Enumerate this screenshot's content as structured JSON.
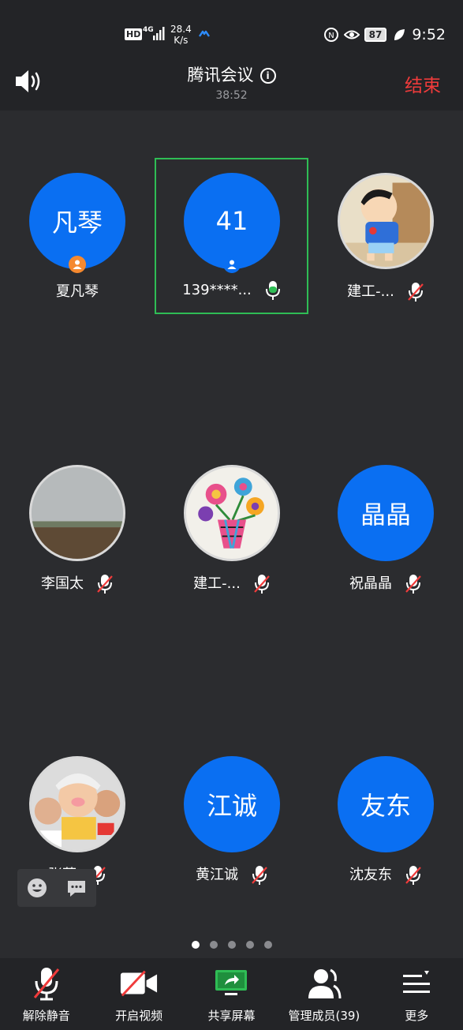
{
  "status_bar": {
    "hd": "HD",
    "network": "4G",
    "speed_value": "28.4",
    "speed_unit": "K/s",
    "battery": "87",
    "time": "9:52"
  },
  "header": {
    "title": "腾讯会议",
    "info_symbol": "i",
    "timer": "38:52",
    "end_label": "结束"
  },
  "participants": [
    {
      "avatar_text": "凡琴",
      "name": "夏凡琴",
      "mic": "none",
      "badge": "host"
    },
    {
      "avatar_text": "41",
      "name": "139****...",
      "mic": "speaking",
      "badge": "member",
      "active": true
    },
    {
      "avatar_text": "",
      "name": "建工-...",
      "mic": "muted",
      "photo": "cartoon-boy-avatar"
    },
    {
      "avatar_text": "",
      "name": "李国太",
      "mic": "muted",
      "photo": "landscape-avatar"
    },
    {
      "avatar_text": "",
      "name": "建工-...",
      "mic": "muted",
      "photo": "flower-vase-drawing-avatar"
    },
    {
      "avatar_text": "晶晶",
      "name": "祝晶晶",
      "mic": "muted"
    },
    {
      "avatar_text": "",
      "name": "张薇",
      "mic": "muted",
      "photo": "family-selfie-avatar"
    },
    {
      "avatar_text": "江诚",
      "name": "黄江诚",
      "mic": "muted"
    },
    {
      "avatar_text": "友东",
      "name": "沈友东",
      "mic": "muted"
    }
  ],
  "pagination": {
    "total": 5,
    "current": 1
  },
  "toolbar": {
    "unmute": "解除静音",
    "video": "开启视频",
    "share": "共享屏幕",
    "members": "管理成员(39)",
    "more": "更多"
  },
  "colors": {
    "accent_blue": "#0a6ff2",
    "end_red": "#f03b3b",
    "speaking_green": "#2fbd55",
    "muted_red": "#f03b3b",
    "background": "#2b2c2f",
    "bar": "#232427",
    "host_orange": "#f5892f"
  }
}
